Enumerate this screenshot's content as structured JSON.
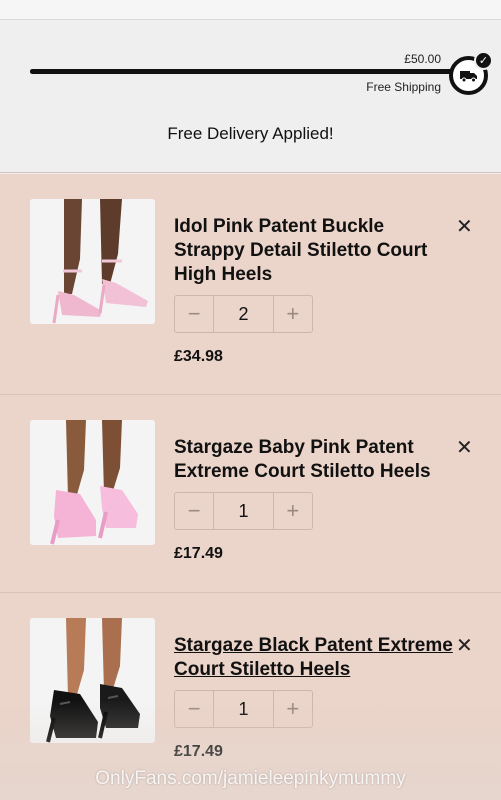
{
  "shipping": {
    "threshold": "£50.00",
    "progress_percent": 100,
    "label": "Free Shipping",
    "applied_message": "Free Delivery Applied!"
  },
  "items": [
    {
      "name": "Idol Pink Patent Buckle Strappy Detail Stiletto Court High Heels",
      "quantity": "2",
      "price": "£34.98",
      "image": "pink-strappy-stiletto-photo",
      "link_style": false
    },
    {
      "name": "Stargaze Baby Pink Patent Extreme Court Stiletto Heels",
      "quantity": "1",
      "price": "£17.49",
      "image": "baby-pink-platform-heel-photo",
      "link_style": false
    },
    {
      "name": "Stargaze Black Patent Extreme Court Stiletto Heels",
      "quantity": "1",
      "price": "£17.49",
      "image": "black-platform-heel-photo",
      "link_style": true
    }
  ],
  "controls": {
    "remove_symbol": "✕",
    "minus_symbol": "−",
    "plus_symbol": "+"
  },
  "watermark": "OnlyFans.com/jamieleepinkymummy",
  "colors": {
    "items_bg": "#ebd4c9",
    "accent": "#111111",
    "page_bg": "#efefef"
  }
}
